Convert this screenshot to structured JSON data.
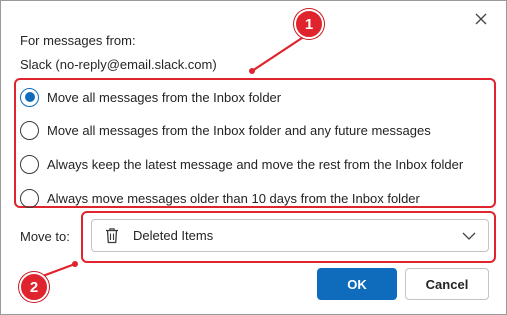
{
  "dialog": {
    "from_label": "For messages from:",
    "sender": "Slack (no-reply@email.slack.com)"
  },
  "options": [
    {
      "label": "Move all messages from the Inbox folder",
      "checked": true
    },
    {
      "label": "Move all messages from the Inbox folder and any future messages",
      "checked": false
    },
    {
      "label": "Always keep the latest message and move the rest from the Inbox folder",
      "checked": false
    },
    {
      "label": "Always move messages older than 10 days from the Inbox folder",
      "checked": false
    }
  ],
  "move_to": {
    "label": "Move to:",
    "folder": "Deleted Items",
    "folder_icon": "trash-icon"
  },
  "buttons": {
    "ok": "OK",
    "cancel": "Cancel"
  },
  "callouts": {
    "one": "1",
    "two": "2"
  },
  "colors": {
    "accent": "#0f6cbd",
    "annotation": "#e0242e"
  }
}
